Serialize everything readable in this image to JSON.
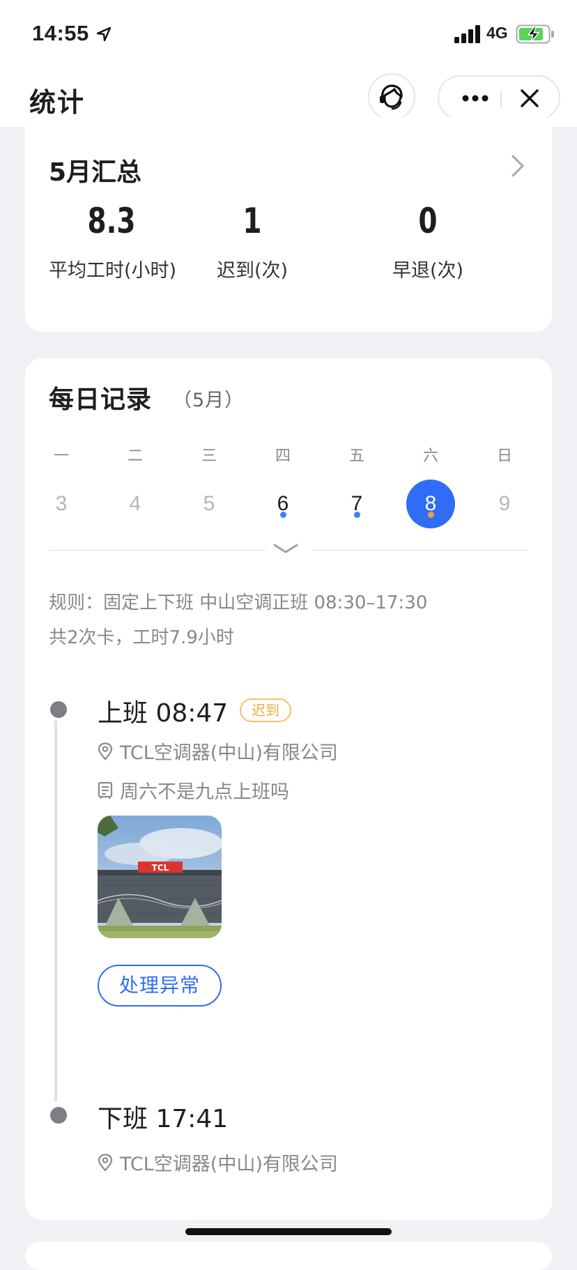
{
  "status_bar": {
    "time": "14:55",
    "network": "4G",
    "icons": [
      "location-arrow-icon",
      "signal-bars-icon",
      "battery-charging-icon"
    ]
  },
  "nav": {
    "title": "统计",
    "icons": [
      "customer-support-icon",
      "more-icon",
      "close-icon"
    ]
  },
  "summary": {
    "title": "5月汇总",
    "stats": [
      {
        "value": "8.3",
        "label": "平均工时(小时)"
      },
      {
        "value": "1",
        "label": "迟到(次)"
      },
      {
        "value": "0",
        "label": "早退(次)"
      }
    ]
  },
  "daily": {
    "title": "每日记录",
    "month": "（5月）",
    "weekdays": [
      "一",
      "二",
      "三",
      "四",
      "五",
      "六",
      "日"
    ],
    "days": [
      "3",
      "4",
      "5",
      "6",
      "7",
      "8",
      "9"
    ],
    "selected_day": "8",
    "rule": "规则：固定上下班 中山空调正班 08:30–17:30",
    "summary_line": "共2次卡，工时7.9小时",
    "records": [
      {
        "heading": "上班 08:47",
        "badge": "迟到",
        "location": "TCL空调器(中山)有限公司",
        "note": "周六不是九点上班吗",
        "photo_sign": "TCL",
        "action": "处理异常"
      },
      {
        "heading": "下班 17:41",
        "location": "TCL空调器(中山)有限公司"
      }
    ]
  },
  "colors": {
    "accent": "#2f6df6",
    "late": "#efac3c",
    "dot_blue": "#3a82f7",
    "dot_orange": "#f29a4a",
    "background": "#eff1f5"
  }
}
